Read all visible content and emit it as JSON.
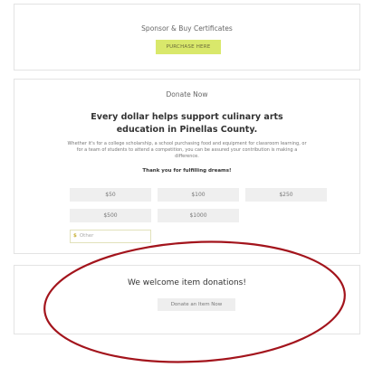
{
  "sponsor": {
    "title": "Sponsor & Buy Certificates",
    "button_label": "PURCHASE HERE"
  },
  "donate": {
    "title": "Donate Now",
    "headline": "Every dollar helps support culinary arts education in Pinellas County.",
    "body": "Whether it's for a college scholarship, a school purchasing food and equipment for classroom learning, or for a team of students to attend a competition, you can be assured your contribution is making a difference.",
    "thanks": "Thank you for fulfilling dreams!",
    "amounts": [
      "$50",
      "$100",
      "$250",
      "$500",
      "$1000"
    ],
    "other": {
      "currency": "$",
      "placeholder": "Other"
    }
  },
  "items": {
    "title": "We welcome item donations!",
    "button_label": "Donate an Item Now"
  },
  "colors": {
    "purchase_button": "#d9e86b",
    "annotation_ellipse": "#a3141c"
  }
}
